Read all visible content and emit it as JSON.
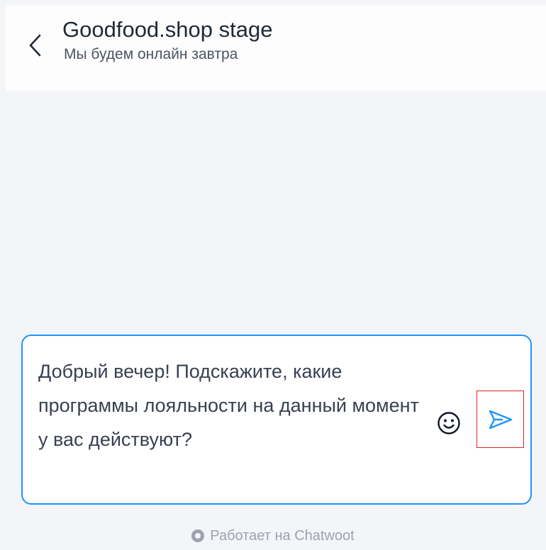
{
  "header": {
    "title": "Goodfood.shop stage",
    "subtitle": "Мы будем онлайн завтра"
  },
  "composer": {
    "message_value": "Добрый вечер! Подскажите, какие программы лояльности на данный момент у вас действуют?",
    "emoji_icon": "smiley-face-icon",
    "send_icon": "paper-plane-send-icon"
  },
  "footer": {
    "powered_by": "Работает на Chatwoot",
    "logo_icon": "chatwoot-logo-icon"
  },
  "colors": {
    "accent": "#1f93ff",
    "background": "#f3f5f9",
    "header_background": "#fdfdfd",
    "highlight_border": "#e02424",
    "footer_text": "#9ca3af"
  }
}
